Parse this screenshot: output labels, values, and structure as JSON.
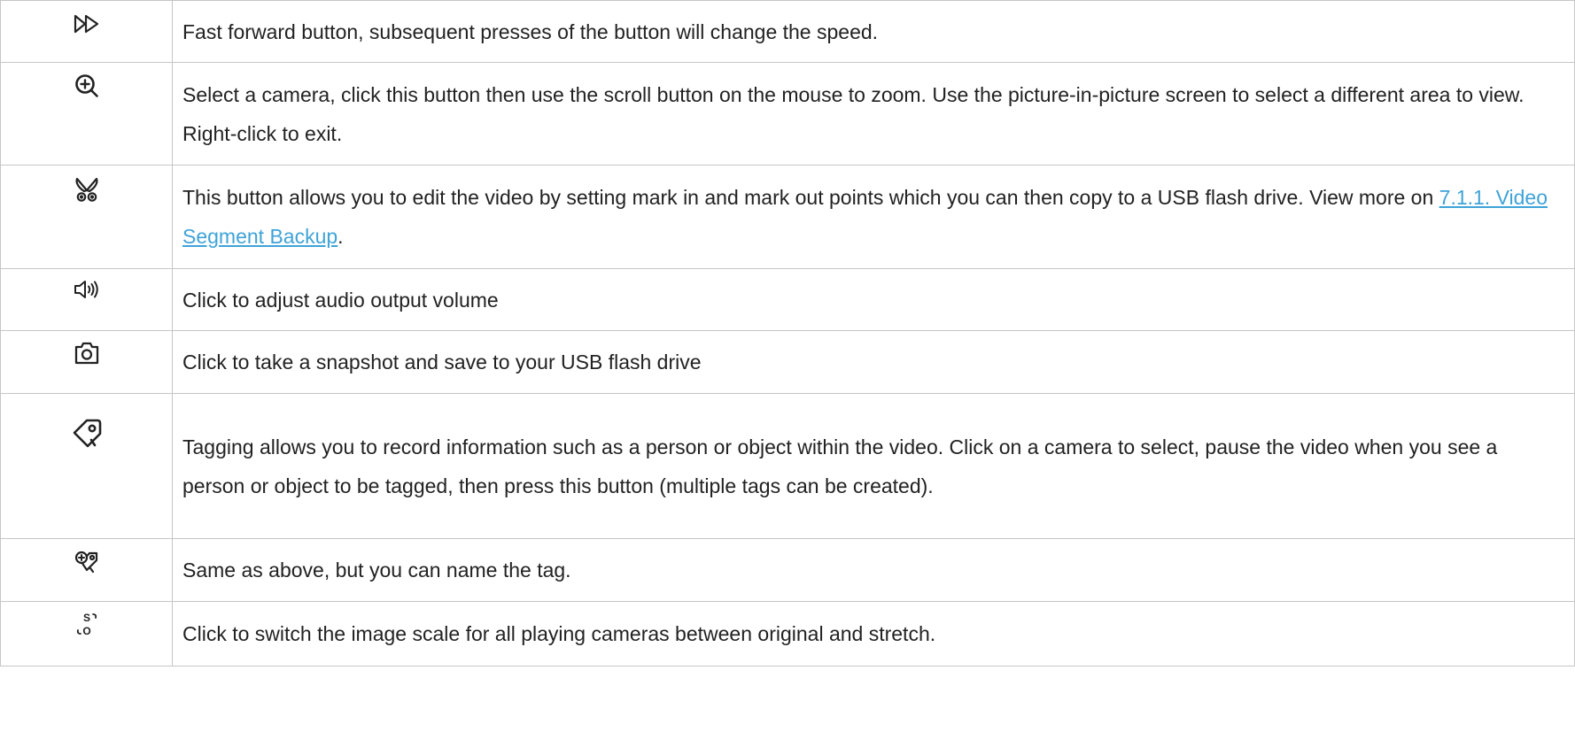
{
  "rows": [
    {
      "icon": "fast-forward-icon",
      "text": "Fast forward button, subsequent presses of the button will change the speed."
    },
    {
      "icon": "zoom-in-icon",
      "text": "Select a camera, click this button then use the scroll button on the mouse to zoom. Use the picture-in-picture screen to select a different area to view. Right-click to exit."
    },
    {
      "icon": "scissors-icon",
      "text_before": "This button allows you to edit the video by setting mark in and mark out points which you can then copy to a USB flash drive. View more on ",
      "link": "7.1.1. Video Segment Backup",
      "text_after": "."
    },
    {
      "icon": "volume-icon",
      "text": "Click to adjust audio output volume"
    },
    {
      "icon": "camera-icon",
      "text": "Click to take a snapshot and save to your USB flash drive"
    },
    {
      "icon": "tag-icon",
      "text": "Tagging allows you to record information such as a person or object within the video. Click on a camera to select, pause the video when you see a person or object to be tagged, then press this button (multiple tags can be created)."
    },
    {
      "icon": "add-tag-icon",
      "text": "Same as above, but you can name the tag."
    },
    {
      "icon": "scale-switch-icon",
      "icon_letters": [
        "S",
        "O"
      ],
      "text": "Click to switch the image scale for all playing cameras between original and stretch."
    }
  ],
  "colors": {
    "border": "#c6c6c6",
    "text": "#222222",
    "link": "#3fa3d8"
  }
}
